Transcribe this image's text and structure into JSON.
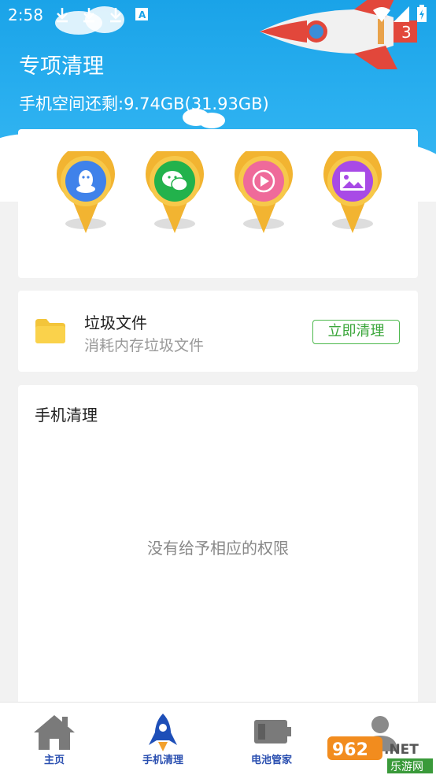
{
  "status_bar": {
    "time": "2:58"
  },
  "header": {
    "title": "专项清理",
    "storage_text": "手机空间还剩:9.74GB(31.93GB)"
  },
  "apps": [
    {
      "name": "qq-pin",
      "icon": "penguin-icon",
      "color": "#3f82ea"
    },
    {
      "name": "wechat-pin",
      "icon": "chat-bubbles-icon",
      "color": "#22b24c"
    },
    {
      "name": "video-pin",
      "icon": "play-icon",
      "color": "#ef6a9a"
    },
    {
      "name": "gallery-pin",
      "icon": "picture-icon",
      "color": "#a84ae6"
    }
  ],
  "junk_card": {
    "title": "垃圾文件",
    "subtitle": "消耗内存垃圾文件",
    "button_label": "立即清理"
  },
  "phone_card": {
    "title": "手机清理",
    "empty_message": "没有给予相应的权限"
  },
  "bottom_nav": {
    "items": [
      {
        "label": "主页",
        "icon": "home-icon"
      },
      {
        "label": "手机清理",
        "icon": "rocket-icon"
      },
      {
        "label": "电池管家",
        "icon": "battery-icon"
      },
      {
        "label": "",
        "icon": "person-icon"
      }
    ]
  },
  "watermark": {
    "text": "962.NET",
    "sub": "乐游网"
  },
  "colors": {
    "header_blue": "#1aa3e8",
    "accent_green": "#4cb84c",
    "nav_blue": "#2a4fb0"
  }
}
